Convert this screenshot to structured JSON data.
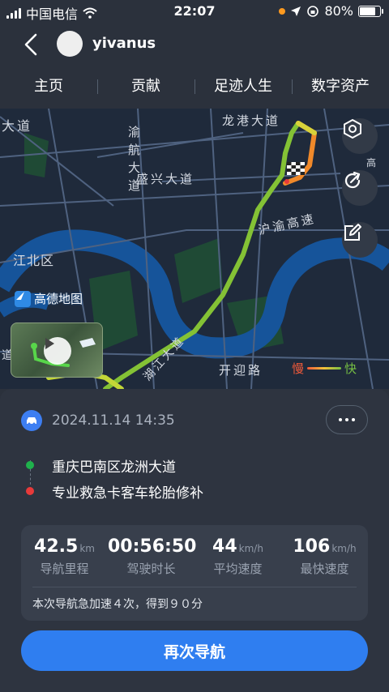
{
  "status_bar": {
    "carrier": "中国电信",
    "time": "22:07",
    "battery_percent": "80%",
    "battery_level": 0.8
  },
  "header": {
    "username": "yivanus"
  },
  "tabs": [
    {
      "label": "主页"
    },
    {
      "label": "贡献"
    },
    {
      "label": "足迹人生"
    },
    {
      "label": "数字资产"
    }
  ],
  "map": {
    "street_labels": {
      "road1": "大道",
      "road2": "渝航大道",
      "road3": "盛兴大道",
      "road4": "龙港大道",
      "road5": "沪渝高速",
      "road6": "江北区",
      "road7": "开迎路",
      "road8": "湖江大道",
      "road9": "道",
      "road10": "高"
    },
    "provider_logo_text": "高德地图",
    "legend": {
      "slow": "慢",
      "fast": "快"
    },
    "colors": {
      "route_fast": "#76c043",
      "route_slow": "#f08a2a",
      "river": "#16549a"
    }
  },
  "trip": {
    "date": "2024.11.14 14:35",
    "start": "重庆巴南区龙洲大道",
    "end": "专业救急卡客车轮胎修补",
    "stats": [
      {
        "value": "42.5",
        "unit": "km",
        "label": "导航里程"
      },
      {
        "value": "00:56:50",
        "unit": "",
        "label": "驾驶时长"
      },
      {
        "value": "44",
        "unit": "km/h",
        "label": "平均速度"
      },
      {
        "value": "106",
        "unit": "km/h",
        "label": "最快速度"
      }
    ],
    "summary": "本次导航急加速４次，得到９０分"
  },
  "cta": {
    "label": "再次导航"
  },
  "colors": {
    "accent": "#2f7ef0",
    "start_dot": "#1fb14c",
    "end_dot": "#e83a3a"
  }
}
